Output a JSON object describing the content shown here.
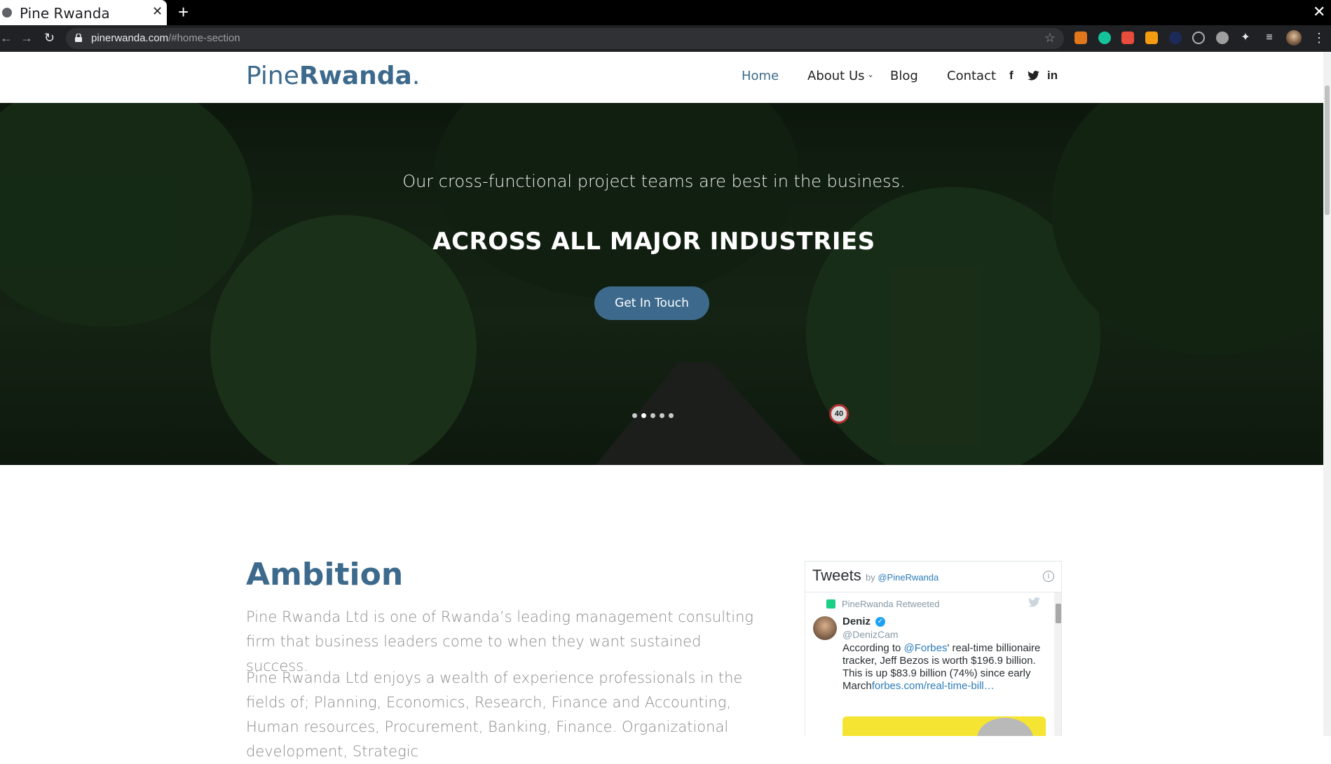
{
  "browser": {
    "tab_title": "Pine Rwanda",
    "tab_close": "✕",
    "new_tab": "+",
    "window_close": "✕",
    "back": "←",
    "forward": "→",
    "reload": "↻",
    "url_host": "pinerwanda.com",
    "url_path": "/#home-section",
    "star": "☆",
    "menu": "⋮"
  },
  "header": {
    "logo_light": "Pine",
    "logo_bold": "Rwanda",
    "logo_dot": ".",
    "nav": {
      "home": "Home",
      "about": "About Us",
      "blog": "Blog",
      "contact": "Contact"
    },
    "caret": "⌄",
    "social": {
      "facebook": "f",
      "twitter": "🐦",
      "linkedin": "in"
    }
  },
  "hero": {
    "subtitle": "Our cross-functional project teams are best in the business.",
    "title": "ACROSS ALL MAJOR INDUSTRIES",
    "button": "Get In Touch",
    "slides": {
      "count": 5,
      "active_index": 1
    },
    "sign": "40"
  },
  "ambition": {
    "title": "Ambition",
    "paragraph1": "Pine Rwanda Ltd is one of Rwanda’s leading management consulting firm that business leaders come to when they want sustained success.",
    "paragraph2": "Pine Rwanda Ltd enjoys a wealth of experience professionals in the fields of; Planning, Economics, Research, Finance and Accounting, Human resources, Procurement, Banking, Finance. Organizational development, Strategic"
  },
  "tweets": {
    "title": "Tweets",
    "by": "by",
    "handle": "@PineRwanda",
    "info": "i",
    "retweeted_label": "PineRwanda Retweeted",
    "author_name": "Deniz",
    "verified": "✓",
    "author_handle": "@DenizCam",
    "text_pre": "According to ",
    "mention": "@Forbes",
    "text_post": "' real-time billionaire tracker, Jeff Bezos is worth $196.9 billion. This is up $83.9 billion (74%) since early March",
    "link": "forbes.com/real-time-bill…"
  },
  "colors": {
    "brand": "#3d6a8c",
    "browser_bg": "#202124",
    "twitter_link": "#2b7bb9",
    "retweet_green": "#19cf86"
  }
}
